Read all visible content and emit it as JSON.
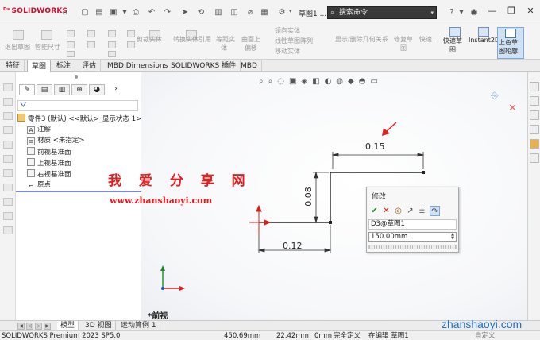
{
  "titlebar": {
    "logo": "SOLIDWORKS",
    "doc_title": "草图1 ...",
    "search_placeholder": "搜索命令",
    "icons": [
      "home-icon",
      "new-icon",
      "open-icon",
      "save-icon",
      "print-icon",
      "undo-icon",
      "select-icon",
      "rebuild-icon",
      "options-icon",
      "help-icon",
      "user-icon",
      "minimize-icon",
      "restore-icon",
      "close-icon"
    ]
  },
  "commands": {
    "exit_sketch": "退出草图",
    "smart_dim": "智能尺寸",
    "trim": "剪裁实体",
    "convert": "转换实体引用",
    "offset_1": "等距实",
    "offset_2": "体",
    "surface_offset_1": "曲面上",
    "surface_offset_2": "偏移",
    "mirror": "镜向实体",
    "linear_pattern": "线性草图阵列",
    "move": "移动实体",
    "display_relations": "显示/删除几何关系",
    "repair_1": "修复草",
    "repair_2": "图",
    "quick_snaps": "快速...",
    "rapid_sketch_1": "快速草",
    "rapid_sketch_2": "图",
    "instant2d": "Instant2D",
    "shaded_1": "上色草",
    "shaded_2": "图轮廓"
  },
  "tabs": [
    "特征",
    "草图",
    "标注",
    "评估",
    "MBD Dimensions",
    "SOLIDWORKS 插件",
    "MBD"
  ],
  "active_tab": "草图",
  "feature_tree": {
    "part": "零件3 (默认) <<默认>_显示状态 1>",
    "items": [
      "注解",
      "材质 <未指定>",
      "前视基准面",
      "上视基准面",
      "右视基准面",
      "原点"
    ]
  },
  "watermark": {
    "title": "我 爱 分 享 网",
    "url": "www.zhanshaoyi.com",
    "bottom": "zhanshaoyi.com"
  },
  "sketch": {
    "dims": [
      "0.15",
      "0.08",
      "0.12"
    ],
    "view_label": "*前视"
  },
  "modify_dialog": {
    "title": "修改",
    "dim_name": "D3@草图1",
    "value": "150.00mm"
  },
  "bottom_tabs": [
    "模型",
    "3D 视图",
    "运动算例 1"
  ],
  "status": {
    "product": "SOLIDWORKS Premium 2023 SP5.0",
    "x": "450.69mm",
    "y": "22.42mm",
    "z": "0mm",
    "state": "完全定义",
    "editing": "在编辑 草图1",
    "custom": "自定义"
  },
  "colors": {
    "accent_blue": "#2b5fa8",
    "watermark_red": "#e02020",
    "axis_red": "#d62020",
    "axis_green": "#1a8a2a",
    "axis_blue": "#1f4fbf"
  }
}
